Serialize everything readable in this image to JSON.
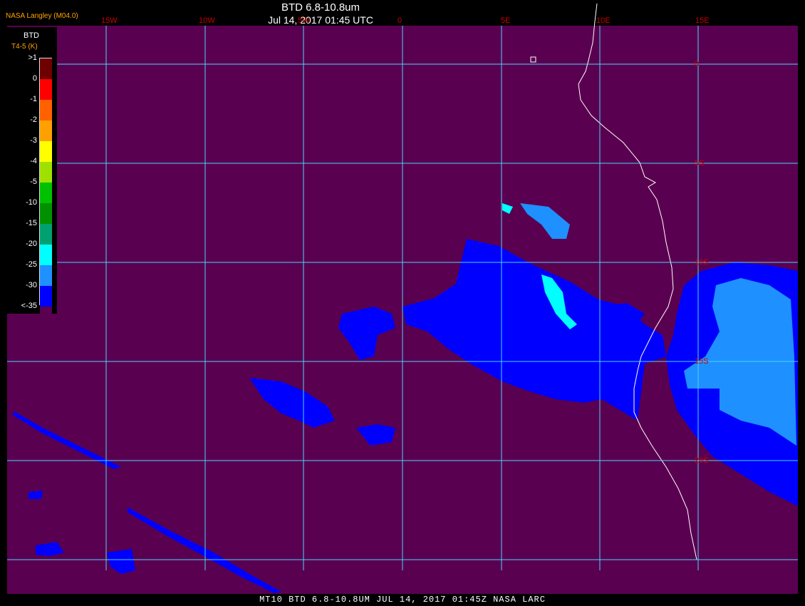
{
  "header": {
    "credit": "NASA Langley (M04.0)",
    "title": "BTD 6.8-10.8um",
    "subtitle": "Jul 14, 2017 01:45 UTC"
  },
  "footer": {
    "caption": "MT10  BTD 6.8-10.8UM  JUL 14, 2017 01:45Z  NASA LARC"
  },
  "colors": {
    "background": "#5a0050",
    "grid": "#48d6ff",
    "coast": "#ffffff",
    "label": "#cc0000"
  },
  "longitude_labels": [
    "15W",
    "10W",
    "5W",
    "0",
    "5E",
    "10E",
    "15E"
  ],
  "latitude_labels": [
    "0",
    "5S",
    "10S",
    "15S",
    "20S"
  ],
  "legend": {
    "title": "BTD",
    "subtitle": "T4-5 (K)",
    "entries": [
      {
        "label": ">1",
        "color": "#6e0000"
      },
      {
        "label": "0",
        "color": "#ff0000"
      },
      {
        "label": "-1",
        "color": "#ff6000"
      },
      {
        "label": "-2",
        "color": "#ffa000"
      },
      {
        "label": "-3",
        "color": "#ffff00"
      },
      {
        "label": "-4",
        "color": "#9fe000"
      },
      {
        "label": "-5",
        "color": "#00c000"
      },
      {
        "label": "-10",
        "color": "#009000"
      },
      {
        "label": "-15",
        "color": "#00a070"
      },
      {
        "label": "-20",
        "color": "#00ffff"
      },
      {
        "label": "-25",
        "color": "#1e90ff"
      },
      {
        "label": "-30",
        "color": "#0000ff"
      },
      {
        "label": "<-35",
        "color": "#5a0050"
      }
    ]
  }
}
